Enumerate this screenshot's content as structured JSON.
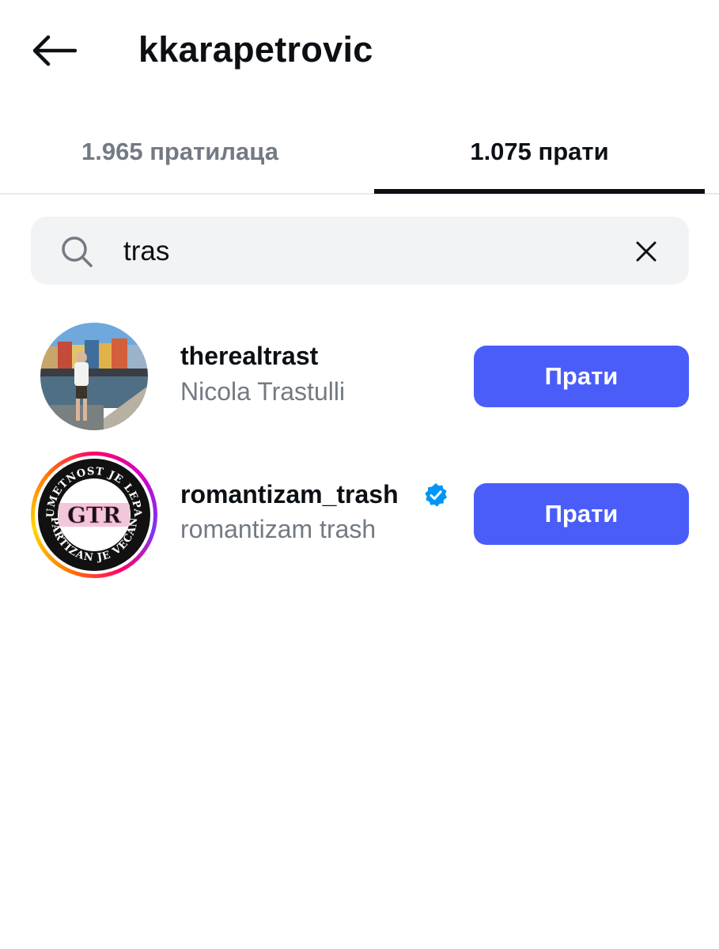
{
  "header": {
    "title": "kkarapetrovic",
    "back_icon": "arrow-left-icon"
  },
  "tabs": [
    {
      "label": "1.965 пратилаца",
      "active": false
    },
    {
      "label": "1.075 прати",
      "active": true
    }
  ],
  "search": {
    "value": "tras",
    "search_icon": "search-icon",
    "clear_icon": "close-icon"
  },
  "users": [
    {
      "username": "therealtrast",
      "full_name": "Nicola Trastulli",
      "verified": false,
      "button_label": "Прати",
      "avatar_icon": "photo-avatar"
    },
    {
      "username": "romantizam_trash",
      "full_name": "romantizam trash",
      "verified": true,
      "button_label": "Прати",
      "avatar_icon": "logo-avatar",
      "avatar_logo_text": {
        "top": "UMETNOST JE LEPA",
        "center": "GTR",
        "bottom": "PARTIZAN JE VEČAN"
      }
    }
  ],
  "colors": {
    "accent": "#4a5df9",
    "primary_text": "#0c1014",
    "secondary_text": "#737a83",
    "search_bg": "#f2f3f5",
    "verified": "#0095f6"
  }
}
